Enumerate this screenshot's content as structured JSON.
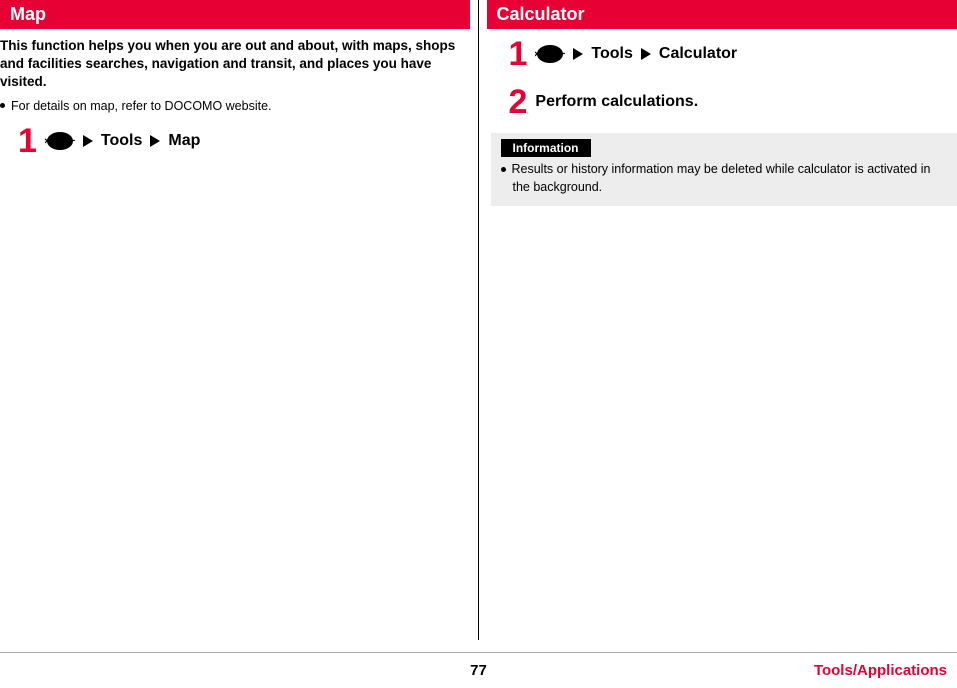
{
  "left": {
    "heading": "Map",
    "intro": "This function helps you when you are out and about, with maps, shops and facilities searches, navigation and transit, and places you have visited.",
    "note": "For details on map, refer to DOCOMO website.",
    "step1": {
      "num": "1",
      "menu_label": "メニュー",
      "part1": "Tools",
      "part2": "Map"
    }
  },
  "right": {
    "heading": "Calculator",
    "step1": {
      "num": "1",
      "menu_label": "メニュー",
      "part1": "Tools",
      "part2": "Calculator"
    },
    "step2": {
      "num": "2",
      "text": "Perform calculations."
    },
    "info": {
      "label": "Information",
      "text": "Results or history information may be deleted while calculator is activated in the background."
    }
  },
  "footer": {
    "page": "77",
    "section": "Tools/Applications"
  }
}
